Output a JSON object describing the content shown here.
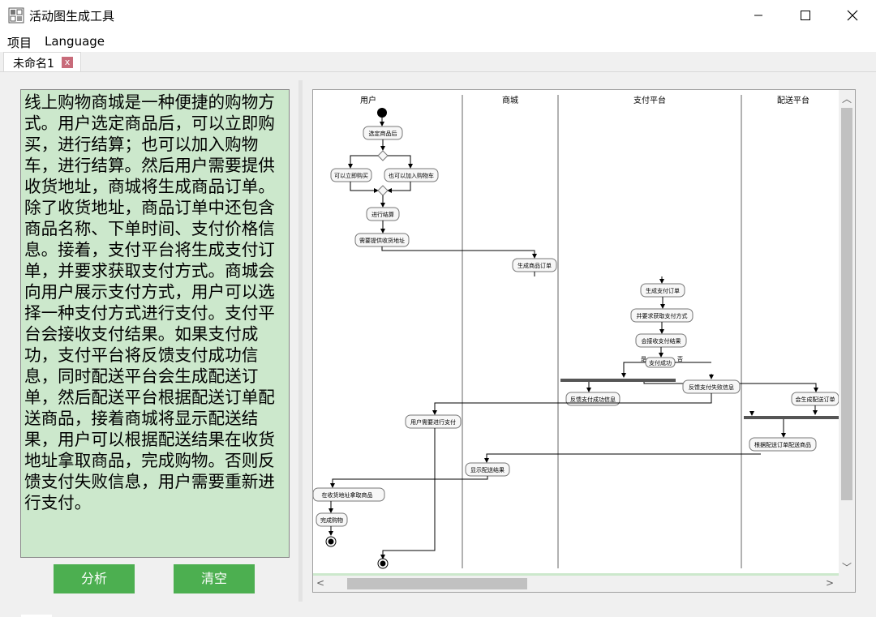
{
  "window": {
    "title": "活动图生成工具",
    "minimize_icon": "minimize-icon",
    "maximize_icon": "maximize-icon",
    "close_icon": "close-icon"
  },
  "menu": {
    "project": "项目",
    "language": "Language"
  },
  "tabs": [
    {
      "label": "未命名1",
      "close": "x"
    }
  ],
  "text_panel": {
    "content": "线上购物商城是一种便捷的购物方式。用户选定商品后，可以立即购买，进行结算；也可以加入购物车，进行结算。然后用户需要提供收货地址，商城将生成商品订单。除了收货地址，商品订单中还包含商品名称、下单时间、支付价格信息。接着，支付平台将生成支付订单，并要求获取支付方式。商城会向用户展示支付方式，用户可以选择一种支付方式进行支付。支付平台会接收支付结果。如果支付成功，支付平台将反馈支付成功信息，同时配送平台会生成配送订单，然后配送平台根据配送订单配送商品，接着商城将显示配送结果，用户可以根据配送结果在收货地址拿取商品，完成购物。否则反馈支付失败信息，用户需要重新进行支付。"
  },
  "buttons": {
    "analyze": "分析",
    "clear": "清空"
  },
  "diagram": {
    "swimlanes": [
      "用户",
      "商城",
      "支付平台",
      "配送平台"
    ],
    "actions": {
      "select_goods": "选定商品后",
      "buy_now": "可以立即购买",
      "add_cart": "也可以加入购物车",
      "checkout": "进行结算",
      "provide_address": "需要提供收货地址",
      "gen_order": "生成商品订单",
      "gen_pay_order": "生成支付订单",
      "request_pay_method": "并要求获取支付方式",
      "receive_result": "会接收支付结果",
      "pay_success_q": "支付成功",
      "feedback_success": "反馈支付成功信息",
      "feedback_fail": "反馈支付失败信息",
      "gen_delivery": "会生成配送订单",
      "select_pay": "用户需要进行支付",
      "deliver": "根据配送订单配送商品",
      "show_result": "显示配送结果",
      "pickup": "在收货地址拿取商品",
      "done": "完成购物"
    },
    "guard_yes": "是",
    "guard_no": "否"
  },
  "colors": {
    "text_panel_bg": "#cce8cc",
    "button_bg": "#4caf50",
    "tab_close_bg": "#c86b7a"
  }
}
